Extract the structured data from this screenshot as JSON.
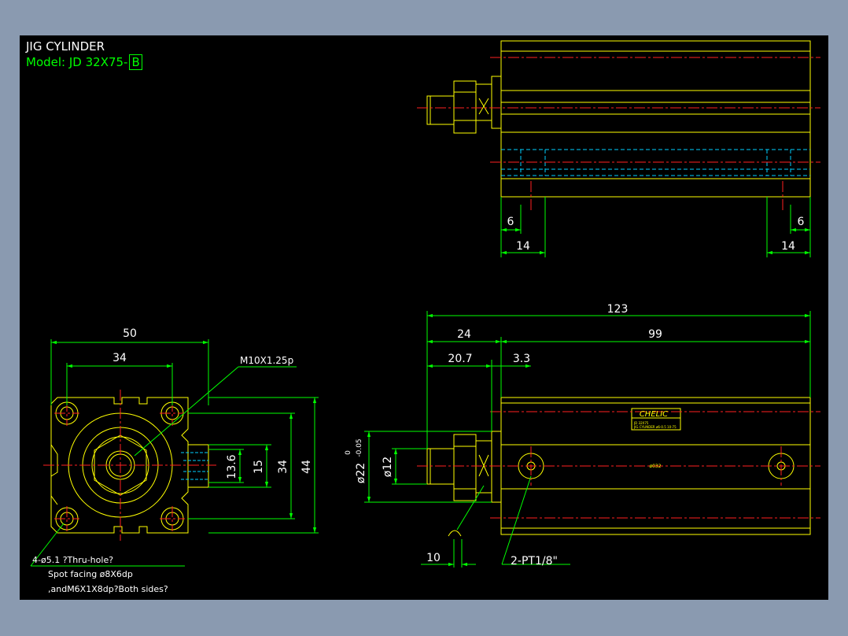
{
  "title": {
    "line1": "JIG CYLINDER",
    "line2": "Model: JD 32X75-",
    "line2_box": "B"
  },
  "dims": {
    "d6_left": "6",
    "d6_right": "6",
    "d14_left": "14",
    "d14_right": "14",
    "d123": "123",
    "d24": "24",
    "d99": "99",
    "d20_7": "20.7",
    "d3_3": "3.3",
    "d50": "50",
    "d34_top": "34",
    "d13_6": "13.6",
    "d15": "15",
    "d34_side": "34",
    "d44": "44",
    "d12": "ø12",
    "d22": "ø22",
    "d22_tol_upper": "0",
    "d22_tol_lower": "-0.05",
    "d10": "10"
  },
  "notes": {
    "thread": "M10X1.25p",
    "port": "2-PT1/8\"",
    "hole_line1": "4-ø5.1 ?Thru-hole?",
    "hole_line2": "Spot facing ø8X6dp",
    "hole_line3": ",andM6X1X8dp?Both sides?",
    "label_brand": "CHELIC",
    "label_line1": "JD 32X75",
    "label_line2": "JIG CYLINDER  ø6-0.5 10-75",
    "bore_text": "ø032"
  },
  "colors": {
    "outline": "#ffff00",
    "dimension": "#00ff00",
    "centerline": "#ff2020",
    "hidden": "#00d0ff",
    "text": "#ffffff"
  }
}
